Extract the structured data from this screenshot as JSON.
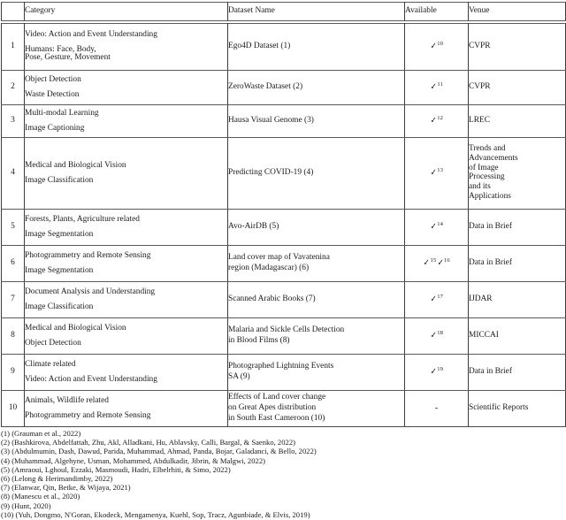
{
  "table": {
    "columns": [
      "",
      "Category",
      "Dataset Name",
      "Available",
      "Venue"
    ],
    "rows": [
      {
        "num": "1",
        "category_lines": [
          "Video: Action and Event Understanding",
          "Humans: Face, Body,",
          "Pose, Gesture, Movement"
        ],
        "dataset_lines": [
          "Ego4D Dataset (1)"
        ],
        "available": "✓",
        "available_sup": "10",
        "available_second": "",
        "available_second_sup": "",
        "venue_lines": [
          "CVPR"
        ]
      },
      {
        "num": "2",
        "category_lines": [
          "Object Detection",
          "Waste Detection"
        ],
        "dataset_lines": [
          "ZeroWaste Dataset (2)"
        ],
        "available": "✓",
        "available_sup": "11",
        "available_second": "",
        "available_second_sup": "",
        "venue_lines": [
          "CVPR"
        ]
      },
      {
        "num": "3",
        "category_lines": [
          "Multi-modal Learning",
          "Image Captioning"
        ],
        "dataset_lines": [
          "Hausa Visual Genome (3)"
        ],
        "available": "✓",
        "available_sup": "12",
        "available_second": "",
        "available_second_sup": "",
        "venue_lines": [
          "LREC"
        ]
      },
      {
        "num": "4",
        "category_lines": [
          "Medical and Biological Vision",
          "Image Classification"
        ],
        "dataset_lines": [
          "Predicting COVID-19 (4)"
        ],
        "available": "✓",
        "available_sup": "13",
        "available_second": "",
        "available_second_sup": "",
        "venue_lines": [
          "Trends and",
          "Advancements",
          "of Image",
          "Processing",
          "and its",
          "Applications"
        ]
      },
      {
        "num": "5",
        "category_lines": [
          "Forests, Plants, Agriculture related",
          "Image Segmentation"
        ],
        "dataset_lines": [
          "Avo-AirDB (5)"
        ],
        "available": "✓",
        "available_sup": "14",
        "available_second": "",
        "available_second_sup": "",
        "venue_lines": [
          "Data in Brief"
        ]
      },
      {
        "num": "6",
        "category_lines": [
          "Photogrammetry and Remote Sensing",
          "Image Segmentation"
        ],
        "dataset_lines": [
          "Land cover map of Vavatenina",
          "region (Madagascar) (6)"
        ],
        "available": "✓",
        "available_sup": "15",
        "available_second": "✓",
        "available_second_sup": "16",
        "venue_lines": [
          "Data in Brief"
        ]
      },
      {
        "num": "7",
        "category_lines": [
          "Document Analysis and Understanding",
          "Image Classification"
        ],
        "dataset_lines": [
          "Scanned Arabic Books (7)"
        ],
        "available": "✓",
        "available_sup": "17",
        "available_second": "",
        "available_second_sup": "",
        "venue_lines": [
          "IJDAR"
        ]
      },
      {
        "num": "8",
        "category_lines": [
          "Medical and Biological Vision",
          "Object Detection"
        ],
        "dataset_lines": [
          "Malaria and Sickle Cells Detection",
          "in Blood Films (8)"
        ],
        "available": "✓",
        "available_sup": "18",
        "available_second": "",
        "available_second_sup": "",
        "venue_lines": [
          "MICCAI"
        ]
      },
      {
        "num": "9",
        "category_lines": [
          "Climate related",
          "Video: Action and Event Understanding"
        ],
        "dataset_lines": [
          "Photographed Lightning Events",
          "SA (9)"
        ],
        "available": "✓",
        "available_sup": "19",
        "available_second": "",
        "available_second_sup": "",
        "venue_lines": [
          "Data in Brief"
        ]
      },
      {
        "num": "10",
        "category_lines": [
          "Animals, Wildlife related",
          "Photogrammetry and Remote Sensing"
        ],
        "dataset_lines": [
          "Effects of Land cover change",
          "on Great Apes distribution",
          "in South East Cameroon (10)"
        ],
        "available": "-",
        "available_sup": "",
        "available_second": "",
        "available_second_sup": "",
        "venue_lines": [
          "Scientific Reports"
        ]
      }
    ]
  },
  "footnotes": [
    {
      "num": "(1)",
      "text": "(Grauman et al., 2022)"
    },
    {
      "num": "(2)",
      "text": "(Bashkirova, Abdelfattah, Zhu, Akl, Alladkani, Hu, Ablavsky, Calli, Bargal, & Saenko, 2022)"
    },
    {
      "num": "(3)",
      "text": "(Abdulmumin, Dash, Dawud, Parida, Muhammad, Ahmad, Panda, Bojar, Galadanci, & Bello, 2022)"
    },
    {
      "num": "(4)",
      "text": "(Muhammad, Algehyne, Usman, Mohammed, Abdulkadir, Jibrin, & Malgwi, 2022)"
    },
    {
      "num": "(5)",
      "text": "(Amraoui, Lghoul, Ezzaki, Masmoudi, Hadri, Elbelrhiti, & Simo, 2022)"
    },
    {
      "num": "(6)",
      "text": "(Lelong & Herimandimby, 2022)"
    },
    {
      "num": "(7)",
      "text": "(Elanwar, Qin, Betke, & Wijaya, 2021)"
    },
    {
      "num": "(8)",
      "text": "(Manescu et al., 2020)"
    },
    {
      "num": "(9)",
      "text": "(Hunt, 2020)"
    },
    {
      "num": "(10)",
      "text": "(Yuh, Dongmo, N'Goran, Ekodeck, Mengamenya, Kuehl, Sop, Tracz, Agunbiade, & Elvis, 2019)"
    }
  ]
}
